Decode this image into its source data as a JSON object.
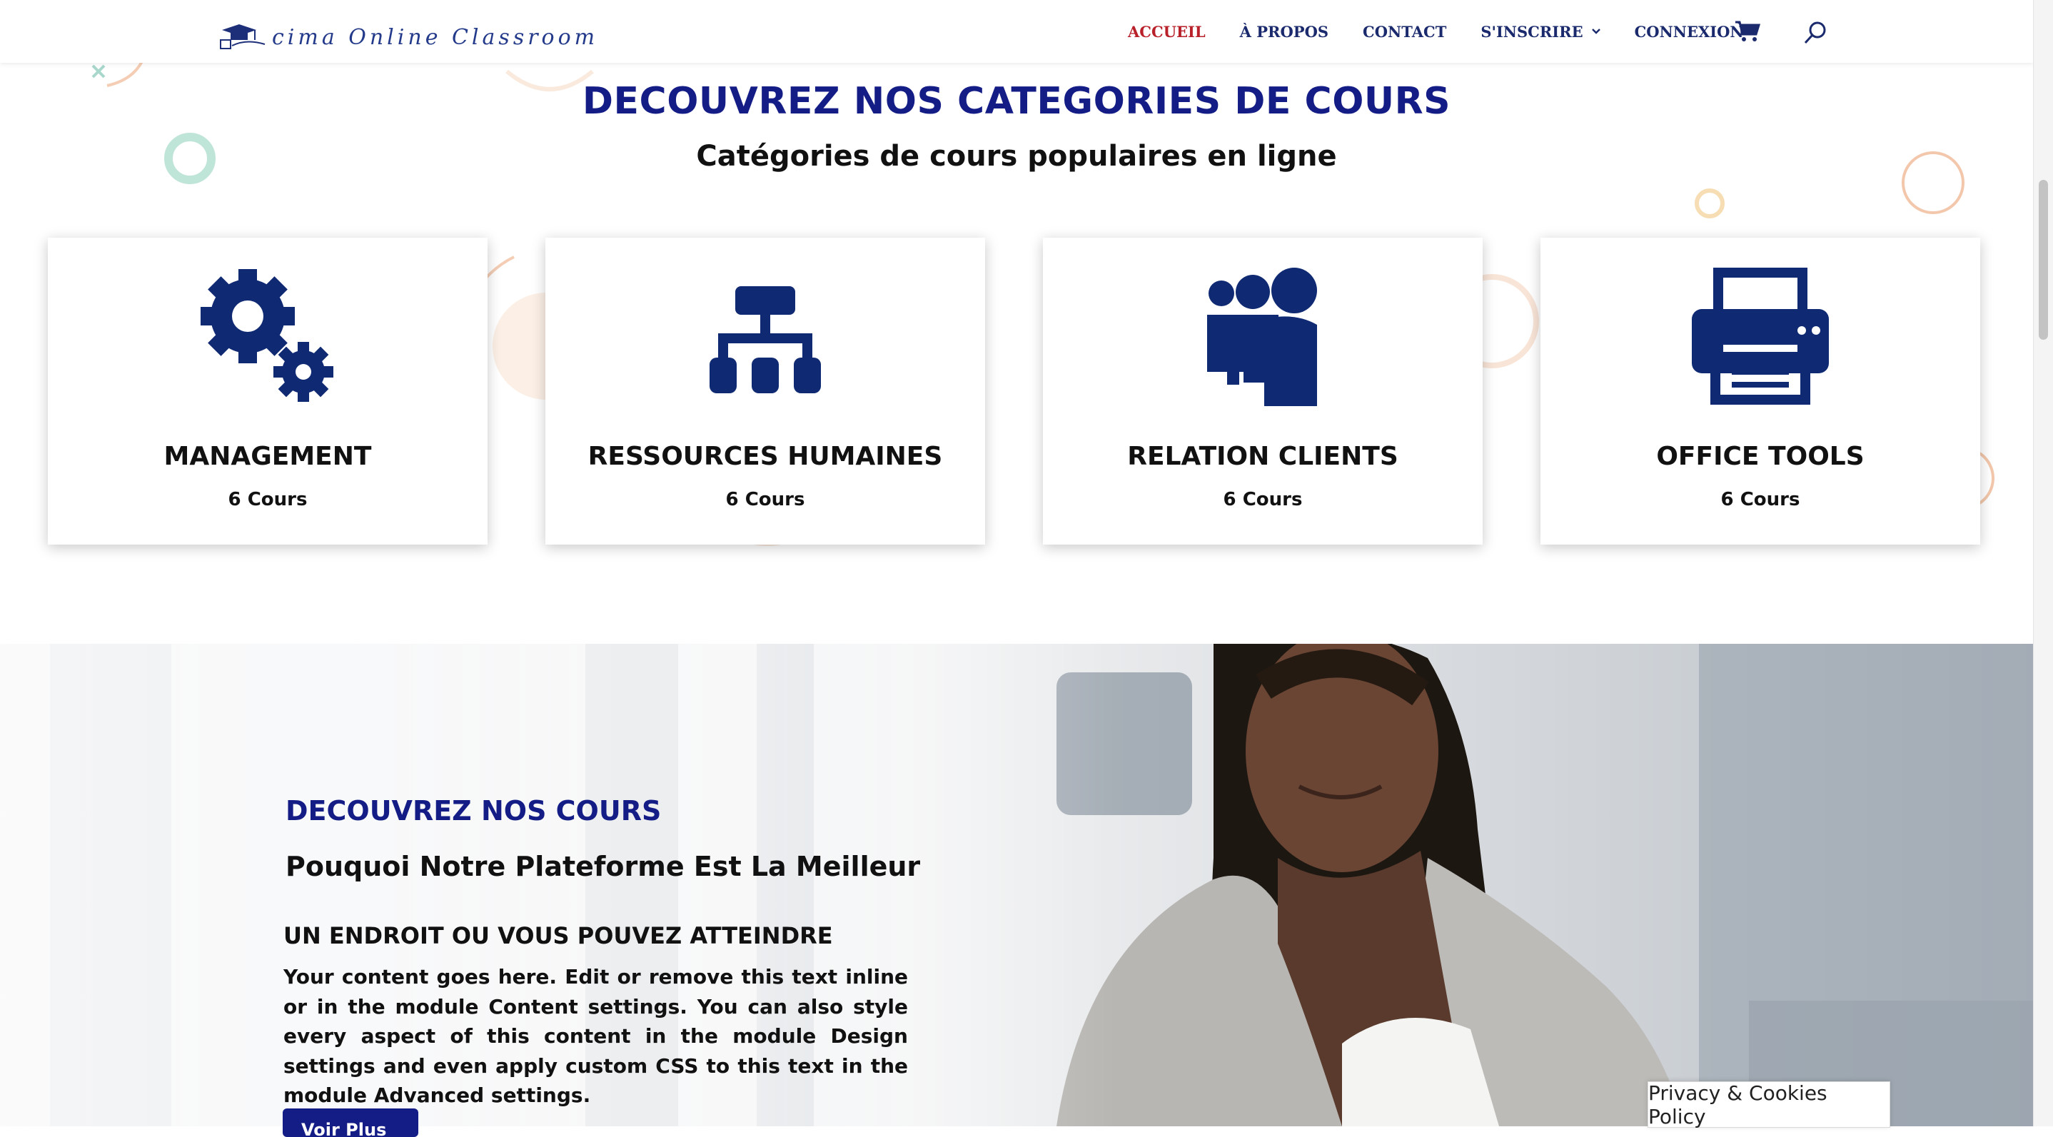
{
  "header": {
    "logo_text": "cima Online Classroom",
    "nav": [
      {
        "label": "ACCUEIL",
        "active": true
      },
      {
        "label": "À PROPOS"
      },
      {
        "label": "CONTACT"
      },
      {
        "label": "S'INSCRIRE",
        "has_dropdown": true
      },
      {
        "label": "CONNEXION"
      }
    ],
    "cart_icon": "shopping-cart-icon",
    "search_icon": "search-icon"
  },
  "categories_section": {
    "title": "DECOUVREZ NOS CATEGORIES DE COURS",
    "subtitle": "Catégories de cours populaires en ligne",
    "cards": [
      {
        "icon": "gears-icon",
        "title": "MANAGEMENT",
        "count": "6 Cours"
      },
      {
        "icon": "org-chart-icon",
        "title": "RESSOURCES HUMAINES",
        "count": "6 Cours"
      },
      {
        "icon": "users-icon",
        "title": "RELATION CLIENTS",
        "count": "6 Cours"
      },
      {
        "icon": "printer-icon",
        "title": "OFFICE TOOLS",
        "count": "6 Cours"
      }
    ]
  },
  "hero": {
    "kicker": "DECOUVREZ NOS COURS",
    "title": "Pouquoi Notre Plateforme Est La Meilleur",
    "subheading": "UN ENDROIT OU VOUS POUVEZ ATTEINDRE",
    "body": "Your content goes here. Edit or remove this text inline or in the module Content settings. You can also style every aspect of this content in the module Design settings and even apply custom CSS to this text in the module Advanced settings.",
    "button_label": "Voir Plus"
  },
  "privacy_label": "Privacy & Cookies Policy",
  "colors": {
    "brand_navy": "#141c86",
    "nav_active": "#b8202a",
    "icon_navy": "#0f2a72"
  }
}
